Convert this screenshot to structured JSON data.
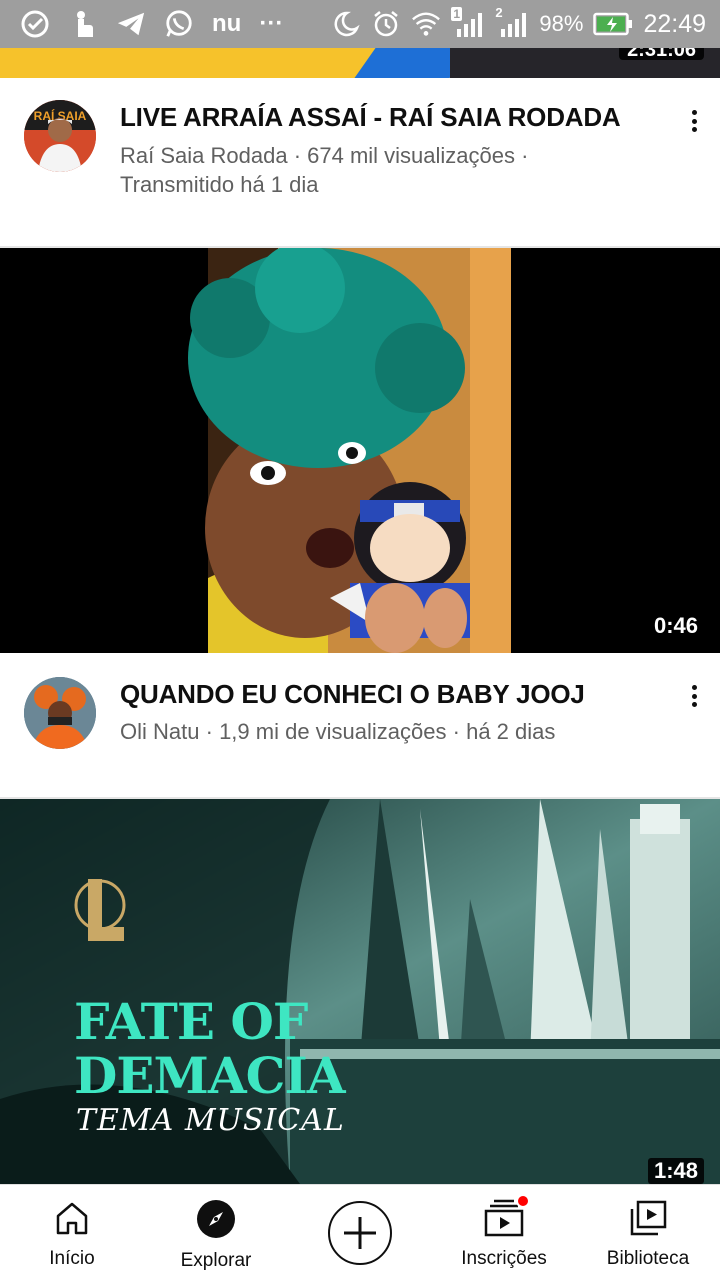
{
  "status_bar": {
    "left_icons": [
      "task-check-icon",
      "hand-touch-icon",
      "telegram-icon",
      "whatsapp-icon",
      "nubank-icon",
      "more-dots-icon"
    ],
    "nu_label": "nu",
    "more_label": "···",
    "sim1_badge": "1",
    "sim2_badge": "2",
    "battery_percent": "98%",
    "time": "22:49"
  },
  "previous_video": {
    "duration": "2:31:06"
  },
  "videos": [
    {
      "title": "LIVE ARRAÍA ASSAÍ - RAÍ SAIA RODADA",
      "channel": "Raí Saia Rodada",
      "views": "674 mil visualizações",
      "separator": "·",
      "age": "Transmitido há 1 dia"
    },
    {
      "title": "QUANDO EU CONHECI O BABY JOOJ",
      "channel": "Oli Natu",
      "views": "1,9 mi de visualizações",
      "separator": "·",
      "age": "há 2 dias",
      "duration": "0:46"
    },
    {
      "duration": "1:48",
      "thumbnail_text": {
        "line1": "FATE OF",
        "line2": "DEMACIA",
        "line3": "TEMA MUSICAL",
        "logo": "L"
      }
    }
  ],
  "bottom_nav": {
    "items": [
      {
        "label": "Início",
        "icon": "home-icon"
      },
      {
        "label": "Explorar",
        "icon": "compass-icon"
      },
      {
        "label": "",
        "icon": "create-plus-icon"
      },
      {
        "label": "Inscrições",
        "icon": "subscriptions-icon"
      },
      {
        "label": "Biblioteca",
        "icon": "library-icon"
      }
    ]
  },
  "colors": {
    "status_bar_bg": "#9e9e9e",
    "text_primary": "#0f0f0f",
    "text_secondary": "#606060",
    "accent_red": "#ff0000",
    "battery_green": "#4caf50"
  }
}
